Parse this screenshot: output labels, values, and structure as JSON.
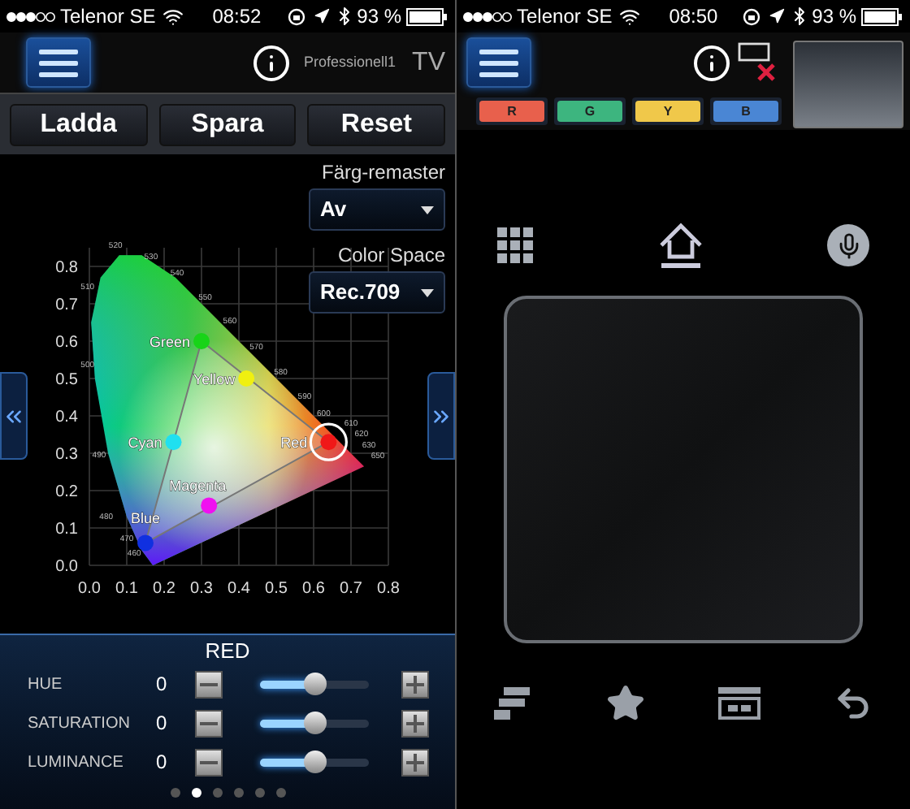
{
  "left_screen": {
    "status_bar": {
      "carrier": "Telenor SE",
      "time": "08:52",
      "battery": "93 %"
    },
    "header": {
      "device_name": "Professionell1",
      "device_type": "TV"
    },
    "actions": [
      "Ladda",
      "Spara",
      "Reset"
    ],
    "settings": [
      {
        "label": "Färg-remaster",
        "value": "Av"
      },
      {
        "label": "Color Space",
        "value": "Rec.709"
      }
    ],
    "chart_data": {
      "type": "scatter",
      "grid": true,
      "xlim": [
        0,
        0.8
      ],
      "ylim": [
        0,
        0.85
      ],
      "xticks": [
        {
          "value": 0,
          "label": "0.0"
        },
        {
          "value": 0.1,
          "label": "0.1"
        },
        {
          "value": 0.2,
          "label": "0.2"
        },
        {
          "value": 0.3,
          "label": "0.3"
        },
        {
          "value": 0.4,
          "label": "0.4"
        },
        {
          "value": 0.5,
          "label": "0.5"
        },
        {
          "value": 0.6,
          "label": "0.6"
        },
        {
          "value": 0.7,
          "label": "0.7"
        },
        {
          "value": 0.8,
          "label": "0.8"
        }
      ],
      "yticks": [
        {
          "value": 0,
          "label": "0.0"
        },
        {
          "value": 0.1,
          "label": "0.1"
        },
        {
          "value": 0.2,
          "label": "0.2"
        },
        {
          "value": 0.3,
          "label": "0.3"
        },
        {
          "value": 0.4,
          "label": "0.4"
        },
        {
          "value": 0.5,
          "label": "0.5"
        },
        {
          "value": 0.6,
          "label": "0.6"
        },
        {
          "value": 0.7,
          "label": "0.7"
        },
        {
          "value": 0.8,
          "label": "0.8"
        }
      ],
      "series": [
        {
          "name": "Green",
          "color": "#18d418",
          "x": [
            0.3
          ],
          "values": [
            0.6
          ]
        },
        {
          "name": "Yellow",
          "color": "#f0f010",
          "x": [
            0.42
          ],
          "values": [
            0.5
          ]
        },
        {
          "name": "Cyan",
          "color": "#20e0f0",
          "x": [
            0.225
          ],
          "values": [
            0.33
          ]
        },
        {
          "name": "Red",
          "color": "#f01818",
          "x": [
            0.64
          ],
          "values": [
            0.33
          ]
        },
        {
          "name": "Magenta",
          "color": "#f010f0",
          "x": [
            0.32
          ],
          "values": [
            0.16
          ]
        },
        {
          "name": "Blue",
          "color": "#1030e0",
          "x": [
            0.15
          ],
          "values": [
            0.06
          ]
        }
      ],
      "annotations": [
        "520",
        "530",
        "540",
        "550",
        "560",
        "570",
        "580",
        "590",
        "600",
        "610",
        "620",
        "630",
        "650",
        "510",
        "500",
        "490",
        "480",
        "470",
        "460"
      ]
    },
    "point_selection": [
      {
        "selected": false
      },
      {
        "selected": false
      },
      {
        "selected": false
      },
      {
        "selected": true
      },
      {
        "selected": false
      },
      {
        "selected": false
      }
    ],
    "adjust_panel": {
      "title": "RED",
      "rows": [
        {
          "label": "HUE",
          "value": "0",
          "level": 0.5
        },
        {
          "label": "SATURATION",
          "value": "0",
          "level": 0.5
        },
        {
          "label": "LUMINANCE",
          "value": "0",
          "level": 0.5
        }
      ]
    },
    "pages": [
      {
        "selected": false
      },
      {
        "selected": true
      },
      {
        "selected": false
      },
      {
        "selected": false
      },
      {
        "selected": false
      },
      {
        "selected": false
      }
    ]
  },
  "right_screen": {
    "status_bar": {
      "carrier": "Telenor SE",
      "time": "08:50",
      "battery": "93 %"
    },
    "color_keys": [
      {
        "label": "R",
        "color": "#e8604c"
      },
      {
        "label": "G",
        "color": "#3db57f"
      },
      {
        "label": "Y",
        "color": "#f0c84a"
      },
      {
        "label": "B",
        "color": "#4a86d4"
      }
    ]
  }
}
